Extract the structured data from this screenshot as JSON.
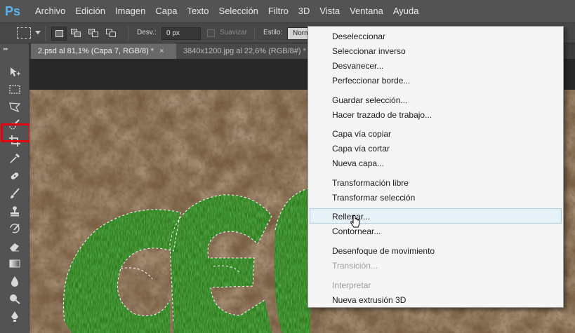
{
  "app": {
    "logo": "Ps",
    "menu": [
      "Archivo",
      "Edición",
      "Imagen",
      "Capa",
      "Texto",
      "Selección",
      "Filtro",
      "3D",
      "Vista",
      "Ventana",
      "Ayuda"
    ]
  },
  "options_bar": {
    "feather_label": "Desv.:",
    "feather_value": "0 px",
    "antialias_label": "Suavizar",
    "style_label": "Estilo:",
    "style_value": "Normal"
  },
  "tabs": [
    {
      "label": "2.psd al 81,1% (Capa 7, RGB/8) *",
      "close": "×",
      "active": true
    },
    {
      "label": "3840x1200.jpg al 22,6% (RGB/8#) *",
      "close": "×",
      "active": false
    }
  ],
  "toolbar": {
    "header": "▸▸",
    "tools": [
      "move-tool-icon",
      "rectangular-marquee-icon",
      "lasso-icon",
      "quick-selection-icon",
      "crop-icon",
      "eyedropper-icon",
      "healing-brush-icon",
      "brush-icon",
      "clone-stamp-icon",
      "history-brush-icon",
      "eraser-icon",
      "gradient-icon",
      "blur-icon",
      "dodge-icon",
      "pen-icon"
    ],
    "selected_tool": "rectangular-marquee-icon"
  },
  "context_menu": {
    "items": [
      {
        "label": "Deseleccionar",
        "enabled": true
      },
      {
        "label": "Seleccionar inverso",
        "enabled": true
      },
      {
        "label": "Desvanecer...",
        "enabled": true
      },
      {
        "label": "Perfeccionar borde...",
        "enabled": true
      },
      {
        "label": "Guardar selección...",
        "enabled": true
      },
      {
        "label": "Hacer trazado de trabajo...",
        "enabled": true
      },
      {
        "label": "Capa vía copiar",
        "enabled": true
      },
      {
        "label": "Capa vía cortar",
        "enabled": true
      },
      {
        "label": "Nueva capa...",
        "enabled": true
      },
      {
        "label": "Transformación libre",
        "enabled": true
      },
      {
        "label": "Transformar selección",
        "enabled": true
      },
      {
        "label": "Rellenar...",
        "enabled": true,
        "hovered": true
      },
      {
        "label": "Contornear...",
        "enabled": true
      },
      {
        "label": "Desenfoque de movimiento",
        "enabled": true
      },
      {
        "label": "Transición...",
        "enabled": false
      },
      {
        "label": "Interpretar",
        "enabled": false
      },
      {
        "label": "Nueva extrusión 3D",
        "enabled": true
      }
    ]
  },
  "colors": {
    "highlight": "#e60012",
    "menu_hover": "#e7f1f8",
    "ps_blue": "#5ab4f0"
  }
}
